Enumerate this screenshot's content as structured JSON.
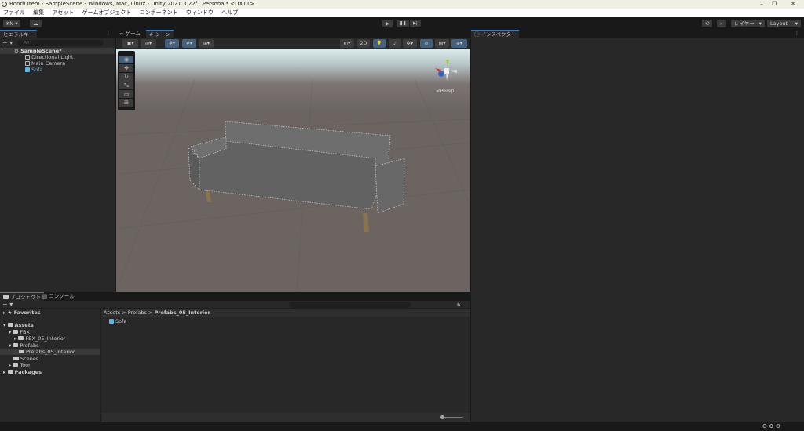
{
  "window": {
    "title": "Booth Item - SampleScene - Windows, Mac, Linux - Unity 2021.3.22f1 Personal* <DX11>",
    "minimize": "–",
    "maximize": "❐",
    "close": "✕"
  },
  "menu": [
    "ファイル",
    "編集",
    "アセット",
    "ゲームオブジェクト",
    "コンポーネント",
    "ウィンドウ",
    "ヘルプ"
  ],
  "toolbar": {
    "account": "KN ▾",
    "cloud": "☁",
    "play": "▶",
    "pause": "❚❚",
    "step": "▶|",
    "history": "⟲",
    "search": "⌕",
    "layers": "レイヤー",
    "layout": "Layout"
  },
  "hierarchy": {
    "tab": "ヒエラルキー",
    "search_placeholder": "All",
    "add": "+ ▾",
    "scene": "SampleScene*",
    "items": [
      "Directional Light",
      "Main Camera",
      "Sofa"
    ]
  },
  "scene_view": {
    "tabs": [
      "ゲーム",
      "シーン"
    ],
    "mode_2d": "2D",
    "persp": "Persp"
  },
  "inspector": {
    "tab": "インスペクター"
  },
  "project": {
    "tabs": [
      "プロジェクト",
      "コンソール"
    ],
    "add": "+ ▾",
    "favorites": "Favorites",
    "tree": {
      "assets": "Assets",
      "fbx": "FBX",
      "fbx_sub": "FBX_05_Interior",
      "prefabs": "Prefabs",
      "prefabs_sub": "Prefabs_05_Interior",
      "scenes": "Scenes",
      "toon": "Toon",
      "packages": "Packages"
    },
    "breadcrumb": [
      "Assets",
      "Prefabs",
      "Prefabs_05_Interior"
    ],
    "files": [
      "Sofa"
    ],
    "hidden_count": "6"
  }
}
